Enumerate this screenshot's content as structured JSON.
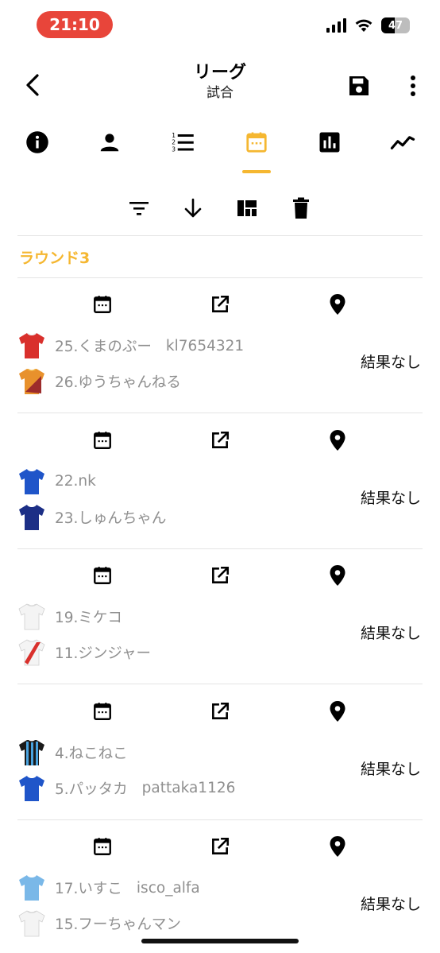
{
  "status_bar": {
    "time": "21:10",
    "battery": "47",
    "battery_level": 0.47
  },
  "header": {
    "title": "リーグ",
    "subtitle": "試合"
  },
  "tabs": [
    {
      "icon": "info-icon",
      "active": false
    },
    {
      "icon": "person-icon",
      "active": false
    },
    {
      "icon": "numbered-list-icon",
      "active": false
    },
    {
      "icon": "calendar-icon",
      "active": true
    },
    {
      "icon": "bar-chart-icon",
      "active": false
    },
    {
      "icon": "trend-line-icon",
      "active": false
    }
  ],
  "toolbar": [
    "filter-icon",
    "arrow-down-icon",
    "layout-icon",
    "trash-icon"
  ],
  "round": {
    "label": "ラウンド3"
  },
  "matches": [
    {
      "home": {
        "name": "25.くまのぷー",
        "extra": "kl7654321",
        "jersey": "red-shirt"
      },
      "away": {
        "name": "26.ゆうちゃんねる",
        "extra": "",
        "jersey": "orange-maroon-shirt"
      },
      "result": "結果なし"
    },
    {
      "home": {
        "name": "22.nk",
        "extra": "",
        "jersey": "blue-shirt"
      },
      "away": {
        "name": "23.しゅんちゃん",
        "extra": "",
        "jersey": "navy-shirt"
      },
      "result": "結果なし"
    },
    {
      "home": {
        "name": "19.ミケコ",
        "extra": "",
        "jersey": "white-shirt"
      },
      "away": {
        "name": "11.ジンジャー",
        "extra": "",
        "jersey": "white-red-sash-shirt"
      },
      "result": "結果なし"
    },
    {
      "home": {
        "name": "4.ねこねこ",
        "extra": "",
        "jersey": "blue-black-striped-shirt"
      },
      "away": {
        "name": "5.パッタカ",
        "extra": "pattaka1126",
        "jersey": "blue-shirt"
      },
      "result": "結果なし"
    },
    {
      "home": {
        "name": "17.いすこ",
        "extra": "isco_alfa",
        "jersey": "sky-blue-shirt"
      },
      "away": {
        "name": "15.フーちゃんマン",
        "extra": "",
        "jersey": "white-shirt"
      },
      "result": "結果なし"
    }
  ],
  "colors": {
    "accent": "#f5b731",
    "time_pill": "#e8453a",
    "secondary_text": "#8f8f8f"
  }
}
